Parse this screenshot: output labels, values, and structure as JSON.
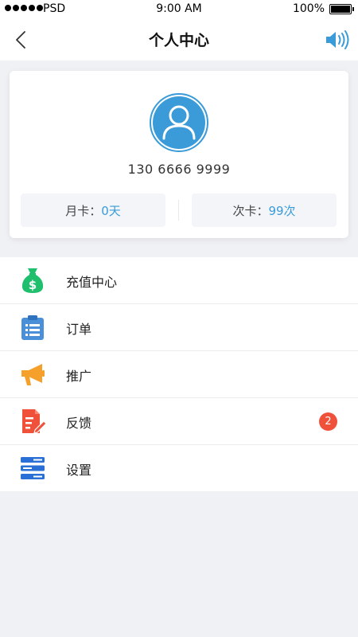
{
  "status_bar": {
    "carrier": "PSD",
    "time": "9:00 AM",
    "battery_percent": "100%"
  },
  "nav": {
    "title": "个人中心",
    "back_icon": "chevron-left-icon",
    "speaker_icon": "speaker-icon"
  },
  "profile": {
    "avatar_icon": "user-avatar-icon",
    "phone": "130 6666 9999",
    "monthly_card_label": "月卡：",
    "monthly_card_value": "0天",
    "count_card_label": "次卡：",
    "count_card_value": "99次"
  },
  "menu": {
    "items": [
      {
        "label": "充值中心",
        "icon": "money-bag-icon",
        "color": "#1fbf6e"
      },
      {
        "label": "订单",
        "icon": "clipboard-list-icon",
        "color": "#4a90d9"
      },
      {
        "label": "推广",
        "icon": "megaphone-icon",
        "color": "#f5a02a"
      },
      {
        "label": "反馈",
        "icon": "feedback-edit-icon",
        "color": "#f0513a",
        "badge": "2"
      },
      {
        "label": "设置",
        "icon": "settings-list-icon",
        "color": "#2a6fd6"
      }
    ]
  },
  "colors": {
    "accent": "#3a9bd8",
    "background": "#f0f1f5",
    "badge": "#f0513a"
  }
}
